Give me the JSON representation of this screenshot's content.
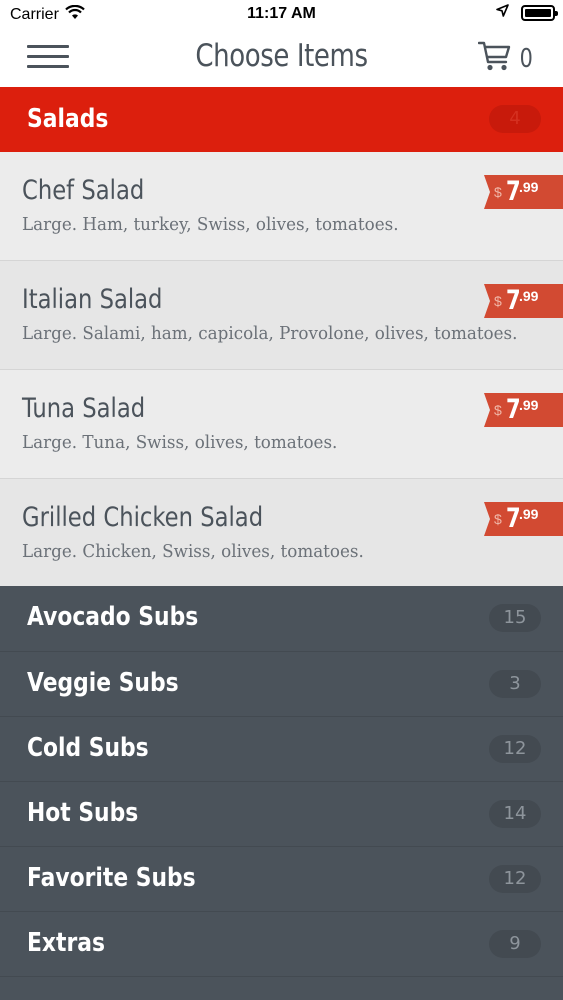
{
  "status_bar": {
    "carrier": "Carrier",
    "time": "11:17 AM"
  },
  "nav": {
    "title": "Choose Items",
    "cart_count": "0"
  },
  "selected_category": {
    "name": "Salads",
    "count": "4"
  },
  "items": [
    {
      "name": "Chef Salad",
      "description": "Large. Ham, turkey, Swiss, olives, tomatoes.",
      "price_symbol": "$",
      "price_whole": "7",
      "price_cents": ".99"
    },
    {
      "name": "Italian Salad",
      "description": "Large. Salami, ham, capicola, Provolone, olives, tomatoes.",
      "price_symbol": "$",
      "price_whole": "7",
      "price_cents": ".99"
    },
    {
      "name": "Tuna Salad",
      "description": "Large. Tuna, Swiss, olives, tomatoes.",
      "price_symbol": "$",
      "price_whole": "7",
      "price_cents": ".99"
    },
    {
      "name": "Grilled Chicken Salad",
      "description": "Large. Chicken, Swiss, olives, tomatoes.",
      "price_symbol": "$",
      "price_whole": "7",
      "price_cents": ".99"
    }
  ],
  "categories": [
    {
      "name": "Avocado Subs",
      "count": "15"
    },
    {
      "name": "Veggie Subs",
      "count": "3"
    },
    {
      "name": "Cold Subs",
      "count": "12"
    },
    {
      "name": "Hot Subs",
      "count": "14"
    },
    {
      "name": "Favorite Subs",
      "count": "12"
    },
    {
      "name": "Extras",
      "count": "9"
    }
  ],
  "colors": {
    "accent": "#dc1f0d",
    "price_tag": "#d24a32",
    "dark": "#4b535b",
    "item_bg": "#ececec"
  },
  "icons": [
    "wifi-icon",
    "location-arrow-icon",
    "battery-icon",
    "menu-icon",
    "cart-icon"
  ]
}
